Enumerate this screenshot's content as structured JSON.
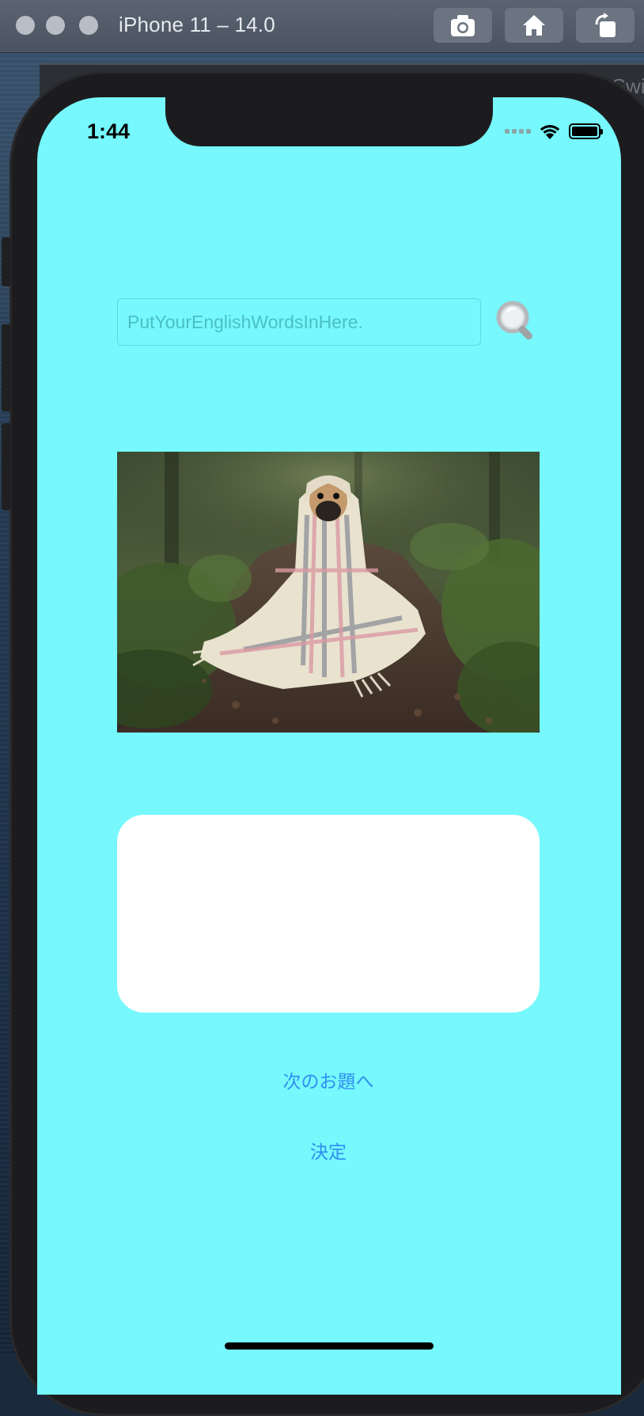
{
  "simulator": {
    "title": "iPhone 11 – 14.0",
    "buttons": [
      "screenshot-icon",
      "home-icon",
      "rotate-icon"
    ],
    "behind_window_text": "Swift"
  },
  "status_bar": {
    "time": "1:44",
    "icons": [
      "signal-icon",
      "wifi-icon",
      "battery-icon"
    ]
  },
  "search": {
    "placeholder": "PutYourEnglishWordsInHere.",
    "value": "",
    "button_icon": "magnifier-icon"
  },
  "photo": {
    "subject": "pug wrapped in blanket"
  },
  "actions": {
    "next_label": "次のお題へ",
    "decide_label": "決定"
  },
  "colors": {
    "screen_background": "#76f8fc",
    "link": "#2f8ff0",
    "card": "#ffffff"
  }
}
